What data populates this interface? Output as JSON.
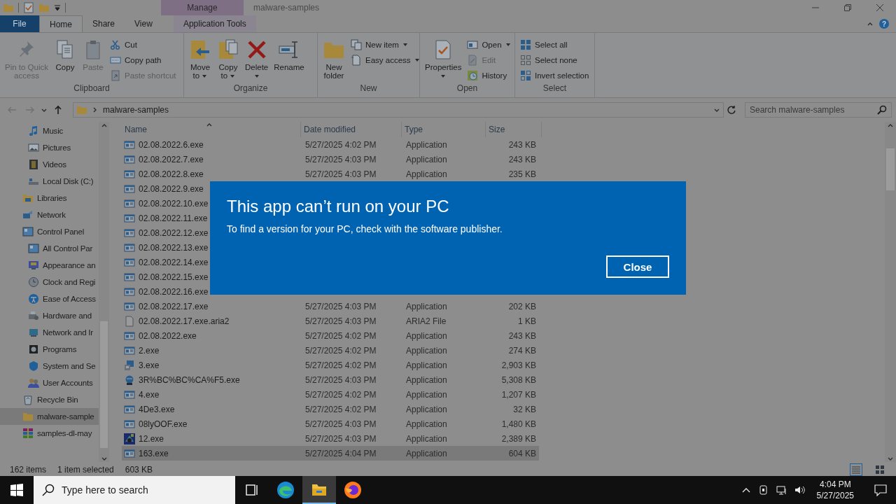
{
  "window": {
    "title": "malware-samples",
    "context_group": "Manage",
    "help": "?"
  },
  "ribbon_tabs": [
    {
      "label": "File",
      "kind": "file",
      "selected": false
    },
    {
      "label": "Home",
      "kind": "tab",
      "selected": true
    },
    {
      "label": "Share",
      "kind": "tab",
      "selected": false
    },
    {
      "label": "View",
      "kind": "tab",
      "selected": false
    },
    {
      "label": "Application Tools",
      "kind": "context",
      "selected": false
    }
  ],
  "ribbon_groups": [
    {
      "label": "Clipboard",
      "items": [
        {
          "label": "Pin to Quick\naccess",
          "kind": "large",
          "disabled": true,
          "dropdown": false
        },
        {
          "label": "Copy",
          "kind": "large",
          "disabled": false,
          "dropdown": false
        },
        {
          "label": "Paste",
          "kind": "large",
          "disabled": true,
          "dropdown": false
        },
        {
          "label": "Cut",
          "kind": "small",
          "disabled": false,
          "dropdown": false
        },
        {
          "label": "Copy path",
          "kind": "small",
          "disabled": false,
          "dropdown": false
        },
        {
          "label": "Paste shortcut",
          "kind": "small",
          "disabled": true,
          "dropdown": false
        }
      ]
    },
    {
      "label": "Organize",
      "items": [
        {
          "label": "Move\nto",
          "kind": "large",
          "disabled": false,
          "dropdown": true
        },
        {
          "label": "Copy\nto",
          "kind": "large",
          "disabled": false,
          "dropdown": true
        },
        {
          "label": "Delete",
          "kind": "large",
          "disabled": false,
          "dropdown": true
        },
        {
          "label": "Rename",
          "kind": "large",
          "disabled": false,
          "dropdown": false
        }
      ]
    },
    {
      "label": "New",
      "items": [
        {
          "label": "New\nfolder",
          "kind": "large",
          "disabled": false,
          "dropdown": false
        },
        {
          "label": "New item",
          "kind": "small",
          "disabled": false,
          "dropdown": true
        },
        {
          "label": "Easy access",
          "kind": "small",
          "disabled": false,
          "dropdown": true
        }
      ]
    },
    {
      "label": "Open",
      "items": [
        {
          "label": "Properties",
          "kind": "large",
          "disabled": false,
          "dropdown": true
        },
        {
          "label": "Open",
          "kind": "small",
          "disabled": false,
          "dropdown": true
        },
        {
          "label": "Edit",
          "kind": "small",
          "disabled": true,
          "dropdown": false
        },
        {
          "label": "History",
          "kind": "small",
          "disabled": false,
          "dropdown": false
        }
      ]
    },
    {
      "label": "Select",
      "items": [
        {
          "label": "Select all",
          "kind": "small",
          "disabled": false,
          "dropdown": false
        },
        {
          "label": "Select none",
          "kind": "small",
          "disabled": false,
          "dropdown": false
        },
        {
          "label": "Invert selection",
          "kind": "small",
          "disabled": false,
          "dropdown": false
        }
      ]
    }
  ],
  "address_bar": {
    "path": [
      "malware-samples"
    ],
    "search_placeholder": "Search malware-samples"
  },
  "navigation": [
    {
      "children": [
        {
          "label": "Music",
          "selected": false
        },
        {
          "label": "Pictures",
          "selected": false
        },
        {
          "label": "Videos",
          "selected": false
        },
        {
          "label": "Local Disk (C:)",
          "selected": false
        }
      ]
    },
    {
      "label": "Libraries",
      "selected": false
    },
    {
      "label": "Network",
      "selected": false
    },
    {
      "label": "Control Panel",
      "selected": false,
      "children": [
        {
          "label": "All Control Par",
          "selected": false
        },
        {
          "label": "Appearance an",
          "selected": false
        },
        {
          "label": "Clock and Regi",
          "selected": false
        },
        {
          "label": "Ease of Access",
          "selected": false
        },
        {
          "label": "Hardware and",
          "selected": false
        },
        {
          "label": "Network and Ir",
          "selected": false
        },
        {
          "label": "Programs",
          "selected": false
        },
        {
          "label": "System and Se",
          "selected": false
        },
        {
          "label": "User Accounts",
          "selected": false
        }
      ]
    },
    {
      "label": "Recycle Bin",
      "selected": false
    },
    {
      "label": "malware-sample",
      "selected": true
    },
    {
      "label": "samples-dl-may",
      "selected": false
    }
  ],
  "file_list": {
    "columns": [
      "Name",
      "Date modified",
      "Type",
      "Size"
    ],
    "rows": [
      {
        "name": "02.08.2022.6.exe",
        "date": "5/27/2025 4:02 PM",
        "type": "Application",
        "size": "243 KB",
        "selected": false
      },
      {
        "name": "02.08.2022.7.exe",
        "date": "5/27/2025 4:03 PM",
        "type": "Application",
        "size": "243 KB",
        "selected": false
      },
      {
        "name": "02.08.2022.8.exe",
        "date": "5/27/2025 4:03 PM",
        "type": "Application",
        "size": "235 KB",
        "selected": false
      },
      {
        "name": "02.08.2022.9.exe",
        "selected": false
      },
      {
        "name": "02.08.2022.10.exe",
        "selected": false
      },
      {
        "name": "02.08.2022.11.exe",
        "selected": false
      },
      {
        "name": "02.08.2022.12.exe",
        "selected": false
      },
      {
        "name": "02.08.2022.13.exe",
        "selected": false
      },
      {
        "name": "02.08.2022.14.exe",
        "selected": false
      },
      {
        "name": "02.08.2022.15.exe",
        "selected": false
      },
      {
        "name": "02.08.2022.16.exe",
        "selected": false
      },
      {
        "name": "02.08.2022.17.exe",
        "date": "5/27/2025 4:03 PM",
        "type": "Application",
        "size": "202 KB",
        "selected": false
      },
      {
        "name": "02.08.2022.17.exe.aria2",
        "date": "5/27/2025 4:03 PM",
        "type": "ARIA2 File",
        "size": "1 KB",
        "selected": false
      },
      {
        "name": "02.08.2022.exe",
        "date": "5/27/2025 4:02 PM",
        "type": "Application",
        "size": "243 KB",
        "selected": false
      },
      {
        "name": "2.exe",
        "date": "5/27/2025 4:02 PM",
        "type": "Application",
        "size": "274 KB",
        "selected": false
      },
      {
        "name": "3.exe",
        "date": "5/27/2025 4:02 PM",
        "type": "Application",
        "size": "2,903 KB",
        "selected": false
      },
      {
        "name": "3R%BC%BC%CA%F5.exe",
        "date": "5/27/2025 4:03 PM",
        "type": "Application",
        "size": "5,308 KB",
        "selected": false
      },
      {
        "name": "4.exe",
        "date": "5/27/2025 4:02 PM",
        "type": "Application",
        "size": "1,207 KB",
        "selected": false
      },
      {
        "name": "4De3.exe",
        "date": "5/27/2025 4:02 PM",
        "type": "Application",
        "size": "32 KB",
        "selected": false
      },
      {
        "name": "08lyOOF.exe",
        "date": "5/27/2025 4:03 PM",
        "type": "Application",
        "size": "1,480 KB",
        "selected": false
      },
      {
        "name": "12.exe",
        "date": "5/27/2025 4:03 PM",
        "type": "Application",
        "size": "2,389 KB",
        "selected": false
      },
      {
        "name": "163.exe",
        "date": "5/27/2025 4:04 PM",
        "type": "Application",
        "size": "604 KB",
        "selected": true
      }
    ]
  },
  "status_bar": {
    "item_count": "162 items",
    "selection": "1 item selected",
    "selection_size": "603 KB",
    "view_buttons": [
      {
        "kind": "details",
        "selected": true
      },
      {
        "kind": "tiles",
        "selected": false
      }
    ]
  },
  "dialog": {
    "title": "This app can’t run on your PC",
    "message": "To find a version for your PC, check with the software publisher.",
    "button": "Close"
  },
  "taskbar": {
    "search_placeholder": "Type here to search",
    "apps": [
      {
        "kind": "task-view",
        "active": false
      },
      {
        "kind": "edge",
        "active": false
      },
      {
        "kind": "explorer",
        "active": true
      },
      {
        "kind": "firefox",
        "active": false
      }
    ],
    "time": "4:04 PM",
    "date": "5/27/2025"
  }
}
